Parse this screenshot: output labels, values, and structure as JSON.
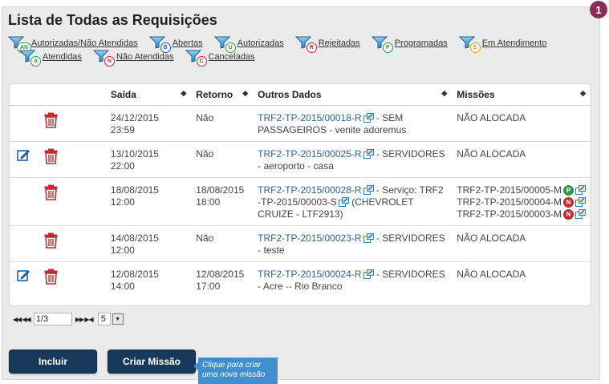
{
  "page": {
    "title": "Lista de Todas as Requisições",
    "step_number": "1"
  },
  "filters_row1": [
    {
      "badge": "AN",
      "label": "Autorizadas/Não Atendidas",
      "color": "#2e9a3a"
    },
    {
      "badge": "B",
      "label": "Abertas",
      "color": "#1d5fa8"
    },
    {
      "badge": "U",
      "label": "Autorizadas",
      "color": "#2e9a3a"
    },
    {
      "badge": "R",
      "label": "Rejeitadas",
      "color": "#c8282d"
    },
    {
      "badge": "P",
      "label": "Programadas",
      "color": "#2e9a3a"
    },
    {
      "badge": "E",
      "label": "Em Atendimento",
      "color": "#e0a21b"
    }
  ],
  "filters_row2": [
    {
      "badge": "A",
      "label": "Atendidas",
      "color": "#2e9a3a"
    },
    {
      "badge": "N",
      "label": "Não Atendidas",
      "color": "#c8282d"
    },
    {
      "badge": "C",
      "label": "Canceladas",
      "color": "#c8282d"
    }
  ],
  "table": {
    "headers": {
      "saida": "Saída",
      "retorno": "Retorno",
      "outros": "Outros Dados",
      "missoes": "Missões"
    },
    "rows": [
      {
        "editable": false,
        "saida_date": "24/12/2015",
        "saida_time": "23:59",
        "retorno_date": "Não",
        "retorno_time": "",
        "req_id": "TRF2-TP-2015/00018-R",
        "req_desc": " - SEM PASSAGEIROS - venite adoremus",
        "missions": [
          {
            "id": "NÃO ALOCADA",
            "status": "",
            "link": false
          }
        ]
      },
      {
        "editable": true,
        "saida_date": "13/10/2015",
        "saida_time": "22:00",
        "retorno_date": "Não",
        "retorno_time": "",
        "req_id": "TRF2-TP-2015/00025-R",
        "req_desc": " - SERVIDORES - aeroporto - casa",
        "missions": [
          {
            "id": "NÃO ALOCADA",
            "status": "",
            "link": false
          }
        ]
      },
      {
        "editable": false,
        "saida_date": "18/08/2015",
        "saida_time": "12:00",
        "retorno_date": "18/08/2015",
        "retorno_time": "18:00",
        "req_id": "TRF2-TP-2015/00028-R",
        "req_desc": " - Serviço: TRF2 -TP-2015/00003-S",
        "req_desc2": " (CHEVROLET CRUIZE - LTF2913)",
        "missions": [
          {
            "id": "TRF2-TP-2015/00005-M",
            "status": "P",
            "link": true
          },
          {
            "id": "TRF2-TP-2015/00004-M",
            "status": "N",
            "link": true
          },
          {
            "id": "TRF2-TP-2015/00003-M",
            "status": "N",
            "link": true
          }
        ]
      },
      {
        "editable": false,
        "saida_date": "14/08/2015",
        "saida_time": "12:00",
        "retorno_date": "Não",
        "retorno_time": "",
        "req_id": "TRF2-TP-2015/00023-R",
        "req_desc": " - SERVIDORES - teste",
        "missions": [
          {
            "id": "NÃO ALOCADA",
            "status": "",
            "link": false
          }
        ]
      },
      {
        "editable": true,
        "saida_date": "12/08/2015",
        "saida_time": "14:00",
        "retorno_date": "12/08/2015",
        "retorno_time": "17:00",
        "req_id": "TRF2-TP-2015/00024-R",
        "req_desc": " - SERVIDORES - Acre -- Rio Branco",
        "missions": [
          {
            "id": "NÃO ALOCADA",
            "status": "",
            "link": false
          }
        ]
      }
    ]
  },
  "pager": {
    "page": "1/3",
    "rows_per_page": "5"
  },
  "buttons": {
    "incluir": "Incluir",
    "criar_missao": "Criar Missão"
  },
  "tooltip": "Clique para criar uma nova missão",
  "colors": {
    "accent_button": "#173a5c",
    "link": "#2d6691",
    "delete": "#c8282d",
    "edit": "#1d5fa8",
    "tooltip": "#3d8fcf",
    "step_badge": "#8a2b5c",
    "status_P": "#2e9a3a",
    "status_N": "#c8282d"
  }
}
